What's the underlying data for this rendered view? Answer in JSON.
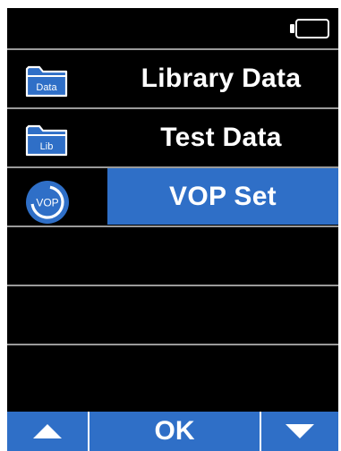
{
  "status_bar": {
    "battery_icon": "battery-icon"
  },
  "menu": {
    "items": [
      {
        "label": "Library Data",
        "icon": "folder-icon",
        "icon_text": "Data",
        "selected": false
      },
      {
        "label": "Test Data",
        "icon": "folder-icon",
        "icon_text": "Lib",
        "selected": false
      },
      {
        "label": "VOP Set",
        "icon": "vop-icon",
        "icon_text": "VOP",
        "selected": true
      },
      {
        "label": "",
        "selected": false
      },
      {
        "label": "",
        "selected": false
      },
      {
        "label": "",
        "selected": false
      }
    ]
  },
  "softkeys": {
    "up_icon": "arrow-up-icon",
    "ok_label": "OK",
    "down_icon": "arrow-down-icon"
  },
  "colors": {
    "accent": "#2f6fc7",
    "screen_bg": "#000000",
    "divider": "#9a9a9a",
    "text": "#ffffff"
  }
}
